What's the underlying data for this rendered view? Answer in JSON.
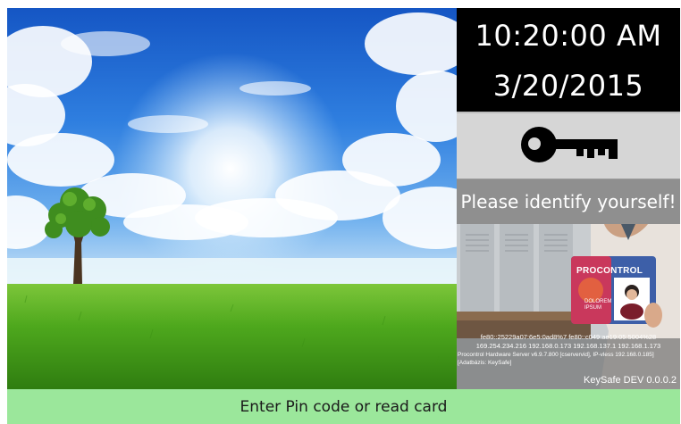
{
  "clock": {
    "time": "10:20:00 AM",
    "date": "3/20/2015"
  },
  "prompt": {
    "text": "Please identify yourself!"
  },
  "card": {
    "brand": "PROCONTROL",
    "small_line1": "DOLOREM",
    "small_line2": "IPSUM"
  },
  "device_info": {
    "line1": "fe80::25229a07:6e5:0ad8%7 fe80::c049:ae19:05:5004%28",
    "line2": "169.254.234.216 192.168.0.173 192.168.137.1 192.168.1.173",
    "line3": "Procontrol Hardware Server v6.9.7.800 [cservervid], IP-vless 192.168.0.185]",
    "line4": "[Adatbázis: KeySafe]"
  },
  "version": "KeySafe DEV 0.0.0.2",
  "status_bar": {
    "text": "Enter Pin code or read card"
  },
  "colors": {
    "clock_bg": "#000000",
    "key_bg": "#d6d6d6",
    "prompt_bg": "#8f8f8f",
    "status_bg": "#9be79b"
  },
  "icons": {
    "key": "key-icon"
  }
}
